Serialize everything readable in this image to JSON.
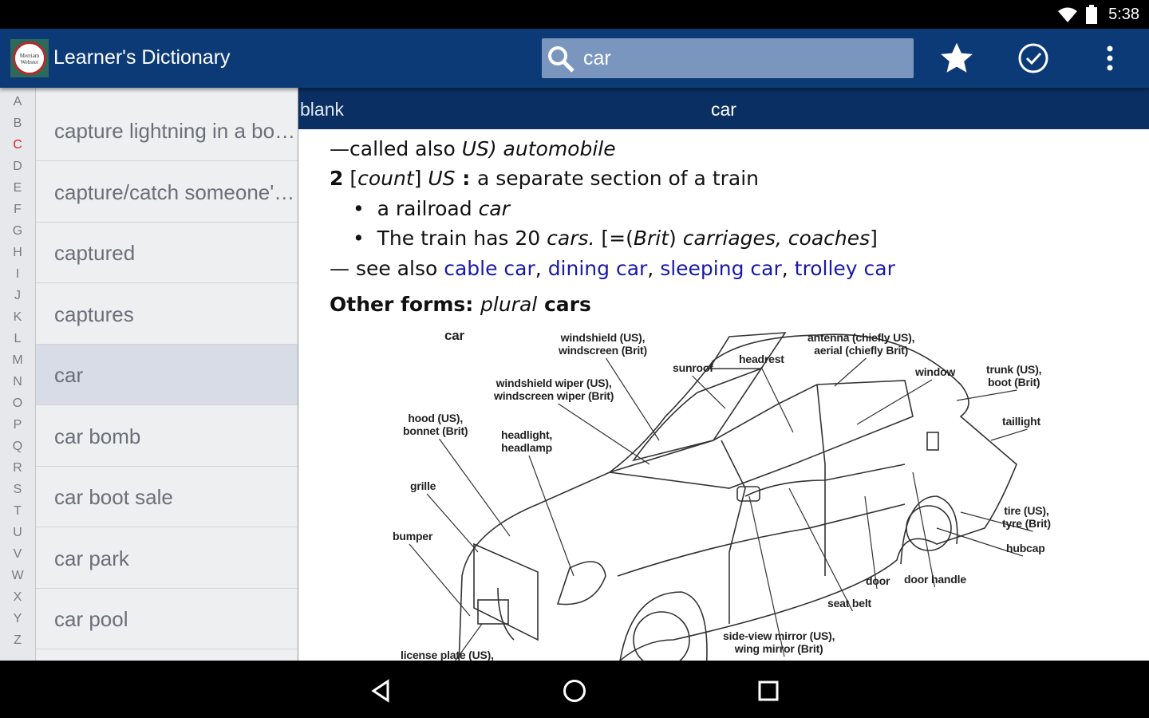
{
  "status_bar": {
    "time": "5:38",
    "icons": [
      "wifi-icon",
      "battery-icon"
    ]
  },
  "app_bar": {
    "title": "Learner's Dictionary",
    "logo_text": "Merriam-Webster",
    "search_value": "car",
    "actions": [
      "star-icon",
      "check-circle-icon",
      "more-vert-icon"
    ]
  },
  "alphabet": [
    "A",
    "B",
    "C",
    "D",
    "E",
    "F",
    "G",
    "H",
    "I",
    "J",
    "K",
    "L",
    "M",
    "N",
    "O",
    "P",
    "Q",
    "R",
    "S",
    "T",
    "U",
    "V",
    "W",
    "X",
    "Y",
    "Z"
  ],
  "alphabet_active": "C",
  "word_list": [
    "capture lightning in a bottle",
    "capture/catch someone's imagination",
    "captured",
    "captures",
    "car",
    "car bomb",
    "car boot sale",
    "car park",
    "car pool"
  ],
  "selected_word": "car",
  "content_header": {
    "prev": "blank",
    "current": "car"
  },
  "entry": {
    "line1_a": "—called also ",
    "line1_b": "US) automobile",
    "sense2_num": "2",
    "sense2_b": " [",
    "sense2_count": "count",
    "sense2_c": "] ",
    "sense2_us": "US",
    "sense2_colon": " : ",
    "sense2_def": "a separate section of a train",
    "ex1_a": "a railroad ",
    "ex1_b": "car",
    "ex2_a": "The train has 20 ",
    "ex2_b": "cars.",
    "ex2_c": " [=(",
    "ex2_d": "Brit",
    "ex2_e": ") ",
    "ex2_f": "carriages, coaches",
    "ex2_g": "]",
    "see_also": "— see also ",
    "links": [
      "cable car",
      "dining car",
      "sleeping car",
      "trolley car"
    ],
    "other_forms_label": "Other forms: ",
    "other_forms_plural": "plural",
    "other_forms_word": " cars"
  },
  "diagram": {
    "title": "car",
    "labels": [
      "windshield (US),\nwindscreen (Brit)",
      "antenna (chiefly US),\naerial (chiefly Brit)",
      "headrest",
      "sunroof",
      "window",
      "trunk (US),\nboot (Brit)",
      "windshield wiper (US),\nwindscreen wiper (Brit)",
      "hood (US),\nbonnet (Brit)",
      "headlight,\nheadlamp",
      "taillight",
      "grille",
      "tire (US),\ntyre (Brit)",
      "bumper",
      "hubcap",
      "door",
      "door handle",
      "seat belt",
      "side-view mirror (US),\nwing mirror (Brit)",
      "license plate (US),"
    ]
  },
  "colors": {
    "app_bar": "#0c3a76",
    "content_header": "#0a2f62",
    "search_box": "#7a96bf",
    "link": "#1a1aa6",
    "active_letter": "#dd2222",
    "selected_row": "#d8dce6"
  }
}
